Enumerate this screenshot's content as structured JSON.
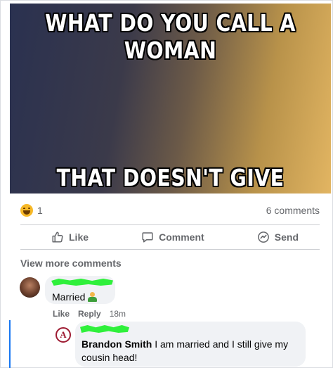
{
  "meme": {
    "top_text": "WHAT DO YOU CALL A WOMAN",
    "bottom_text": "THAT DOESN'T GIVE HEAD"
  },
  "reactions": {
    "icon": "haha-icon",
    "count": "1",
    "comments_count": "6 comments"
  },
  "actions": {
    "like": "Like",
    "comment": "Comment",
    "send": "Send"
  },
  "view_more_comments": "View more comments",
  "comments": [
    {
      "text": "Married",
      "emoji": "person-emoji",
      "like_label": "Like",
      "reply_label": "Reply",
      "time": "18m"
    }
  ],
  "reply": {
    "author": "Brandon Smith",
    "text": "I am married and I still give my cousin head!",
    "avatar_letter": "A"
  },
  "colors": {
    "secondary_text": "#65676b",
    "bubble_bg": "#f0f2f5",
    "reply_line": "#1877f2",
    "redaction": "#2ff03b"
  }
}
